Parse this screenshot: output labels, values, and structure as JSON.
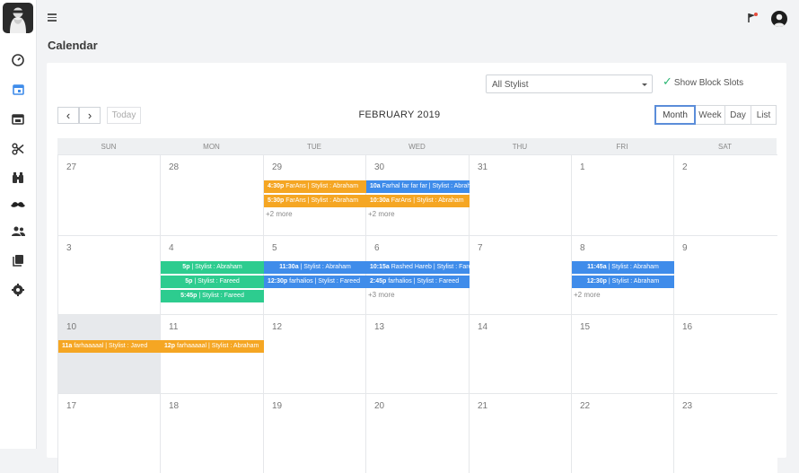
{
  "page": {
    "title": "Calendar"
  },
  "colors": {
    "orange": "#f5a623",
    "blue": "#3f8cea",
    "green": "#2dcc8f",
    "active_view": "#5b8dd9"
  },
  "sidebar": {
    "items": [
      "dashboard-icon",
      "calendar-icon",
      "appointments-icon",
      "scissors-icon",
      "binoculars-icon",
      "mustache-icon",
      "users-icon",
      "books-icon",
      "settings-icon"
    ]
  },
  "filters": {
    "stylist_select": "All Stylist",
    "show_block_slots": "Show Block Slots"
  },
  "toolbar": {
    "prev": "‹",
    "next": "›",
    "today": "Today",
    "month_title": "FEBRUARY 2019",
    "views": [
      "Month",
      "Week",
      "Day",
      "List"
    ],
    "active_view": "Month"
  },
  "calendar": {
    "weekdays": [
      "SUN",
      "MON",
      "TUE",
      "WED",
      "THU",
      "FRI",
      "SAT"
    ],
    "weeks": [
      [
        "27",
        "28",
        "29",
        "30",
        "31",
        "1",
        "2"
      ],
      [
        "3",
        "4",
        "5",
        "6",
        "7",
        "8",
        "9"
      ],
      [
        "10",
        "11",
        "12",
        "13",
        "14",
        "15",
        "16"
      ],
      [
        "17",
        "18",
        "19",
        "20",
        "21",
        "22",
        "23"
      ]
    ],
    "highlighted": "10",
    "events": [
      {
        "week": 0,
        "day": 2,
        "slot": 0,
        "span": 1,
        "color": "orange",
        "time": "4:30p",
        "text": " FarAns | Stylist : Abraham"
      },
      {
        "week": 0,
        "day": 2,
        "slot": 1,
        "span": 1,
        "color": "orange",
        "time": "5:30p",
        "text": " FarAns | Stylist : Abraham"
      },
      {
        "week": 0,
        "day": 3,
        "slot": 0,
        "span": 1,
        "color": "blue",
        "time": "10a",
        "text": " Farhal far far far | Stylist : Abraham"
      },
      {
        "week": 0,
        "day": 3,
        "slot": 1,
        "span": 1,
        "color": "orange",
        "time": "10:30a",
        "text": " FarAns | Stylist : Abraham"
      },
      {
        "week": 1,
        "day": 1,
        "slot": 0,
        "span": 1,
        "color": "green",
        "time": "5p",
        "text": " | Stylist : Abraham",
        "center": true
      },
      {
        "week": 1,
        "day": 1,
        "slot": 1,
        "span": 1,
        "color": "green",
        "time": "5p",
        "text": " | Stylist : Fareed",
        "center": true
      },
      {
        "week": 1,
        "day": 1,
        "slot": 2,
        "span": 1,
        "color": "green",
        "time": "5:45p",
        "text": " | Stylist : Fareed",
        "center": true
      },
      {
        "week": 1,
        "day": 2,
        "slot": 0,
        "span": 1,
        "color": "blue",
        "time": "11:30a",
        "text": " | Stylist : Abraham",
        "center": true
      },
      {
        "week": 1,
        "day": 2,
        "slot": 1,
        "span": 1,
        "color": "blue",
        "time": "12:30p",
        "text": " farhalios | Stylist : Fareed"
      },
      {
        "week": 1,
        "day": 3,
        "slot": 0,
        "span": 1,
        "color": "blue",
        "time": "10:15a",
        "text": " Rashed Hareb | Stylist : Fareed"
      },
      {
        "week": 1,
        "day": 3,
        "slot": 1,
        "span": 1,
        "color": "blue",
        "time": "2:45p",
        "text": " farhalios | Stylist : Fareed"
      },
      {
        "week": 1,
        "day": 5,
        "slot": 0,
        "span": 1,
        "color": "blue",
        "time": "11:45a",
        "text": " | Stylist : Abraham",
        "center": true
      },
      {
        "week": 1,
        "day": 5,
        "slot": 1,
        "span": 1,
        "color": "blue",
        "time": "12:30p",
        "text": " | Stylist : Abraham",
        "center": true
      },
      {
        "week": 2,
        "day": 0,
        "slot": 0,
        "span": 1,
        "color": "orange",
        "time": "11a",
        "text": " farhaaaaal | Stylist : Javed"
      },
      {
        "week": 2,
        "day": 1,
        "slot": 0,
        "span": 1,
        "color": "orange",
        "time": "12p",
        "text": " farhaaaaal | Stylist : Abraham"
      }
    ],
    "more_links": [
      {
        "week": 0,
        "day": 2,
        "slot": 2,
        "text": "+2 more"
      },
      {
        "week": 0,
        "day": 3,
        "slot": 2,
        "text": "+2 more"
      },
      {
        "week": 1,
        "day": 3,
        "slot": 2,
        "text": "+3 more"
      },
      {
        "week": 1,
        "day": 5,
        "slot": 2,
        "text": "+2 more"
      }
    ]
  }
}
